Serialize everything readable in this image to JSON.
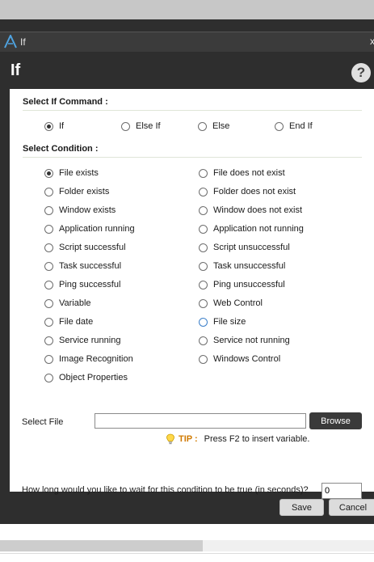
{
  "window": {
    "title": "If",
    "close": "x"
  },
  "header": {
    "title": "If",
    "help": "?"
  },
  "command": {
    "heading": "Select If Command :",
    "options": [
      "If",
      "Else If",
      "Else",
      "End If"
    ],
    "selected": "If"
  },
  "condition": {
    "heading": "Select Condition :",
    "left": [
      "File exists",
      "Folder exists",
      "Window exists",
      "Application running",
      "Script successful",
      "Task successful",
      "Ping successful",
      "Variable",
      "File date",
      "Service running",
      "Image Recognition",
      "Object Properties"
    ],
    "right": [
      "File does not exist",
      "Folder does not exist",
      "Window does not exist",
      "Application not running",
      "Script unsuccessful",
      "Task unsuccessful",
      "Ping unsuccessful",
      "Web Control",
      "File size",
      "Service not running",
      "Windows Control"
    ],
    "selected": "File exists",
    "focused": "File size"
  },
  "file": {
    "label": "Select File",
    "value": "",
    "browse": "Browse"
  },
  "tip": {
    "tag": "TIP :",
    "text": "Press F2 to insert variable."
  },
  "wait": {
    "label": "How long would you like to wait for this condition to be true (in seconds)?",
    "value": "0"
  },
  "footer": {
    "save": "Save",
    "cancel": "Cancel"
  }
}
